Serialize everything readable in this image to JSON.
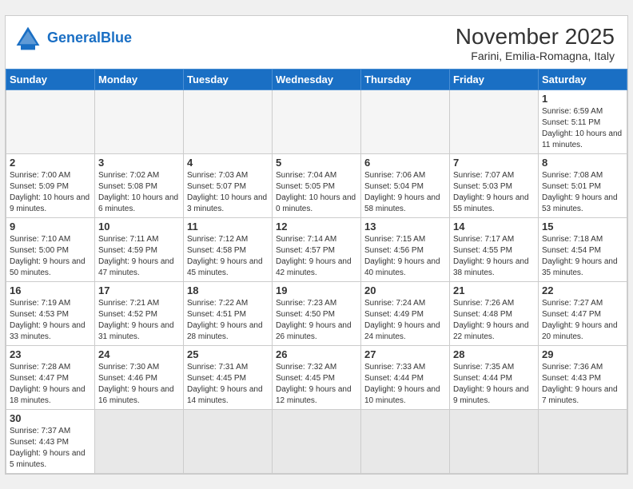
{
  "header": {
    "logo_general": "General",
    "logo_blue": "Blue",
    "month_year": "November 2025",
    "location": "Farini, Emilia-Romagna, Italy"
  },
  "days_of_week": [
    "Sunday",
    "Monday",
    "Tuesday",
    "Wednesday",
    "Thursday",
    "Friday",
    "Saturday"
  ],
  "weeks": [
    [
      {
        "day": null,
        "empty": true
      },
      {
        "day": null,
        "empty": true
      },
      {
        "day": null,
        "empty": true
      },
      {
        "day": null,
        "empty": true
      },
      {
        "day": null,
        "empty": true
      },
      {
        "day": null,
        "empty": true
      },
      {
        "day": 1,
        "info": "Sunrise: 6:59 AM\nSunset: 5:11 PM\nDaylight: 10 hours and 11 minutes."
      }
    ],
    [
      {
        "day": 2,
        "info": "Sunrise: 7:00 AM\nSunset: 5:09 PM\nDaylight: 10 hours and 9 minutes."
      },
      {
        "day": 3,
        "info": "Sunrise: 7:02 AM\nSunset: 5:08 PM\nDaylight: 10 hours and 6 minutes."
      },
      {
        "day": 4,
        "info": "Sunrise: 7:03 AM\nSunset: 5:07 PM\nDaylight: 10 hours and 3 minutes."
      },
      {
        "day": 5,
        "info": "Sunrise: 7:04 AM\nSunset: 5:05 PM\nDaylight: 10 hours and 0 minutes."
      },
      {
        "day": 6,
        "info": "Sunrise: 7:06 AM\nSunset: 5:04 PM\nDaylight: 9 hours and 58 minutes."
      },
      {
        "day": 7,
        "info": "Sunrise: 7:07 AM\nSunset: 5:03 PM\nDaylight: 9 hours and 55 minutes."
      },
      {
        "day": 8,
        "info": "Sunrise: 7:08 AM\nSunset: 5:01 PM\nDaylight: 9 hours and 53 minutes."
      }
    ],
    [
      {
        "day": 9,
        "info": "Sunrise: 7:10 AM\nSunset: 5:00 PM\nDaylight: 9 hours and 50 minutes."
      },
      {
        "day": 10,
        "info": "Sunrise: 7:11 AM\nSunset: 4:59 PM\nDaylight: 9 hours and 47 minutes."
      },
      {
        "day": 11,
        "info": "Sunrise: 7:12 AM\nSunset: 4:58 PM\nDaylight: 9 hours and 45 minutes."
      },
      {
        "day": 12,
        "info": "Sunrise: 7:14 AM\nSunset: 4:57 PM\nDaylight: 9 hours and 42 minutes."
      },
      {
        "day": 13,
        "info": "Sunrise: 7:15 AM\nSunset: 4:56 PM\nDaylight: 9 hours and 40 minutes."
      },
      {
        "day": 14,
        "info": "Sunrise: 7:17 AM\nSunset: 4:55 PM\nDaylight: 9 hours and 38 minutes."
      },
      {
        "day": 15,
        "info": "Sunrise: 7:18 AM\nSunset: 4:54 PM\nDaylight: 9 hours and 35 minutes."
      }
    ],
    [
      {
        "day": 16,
        "info": "Sunrise: 7:19 AM\nSunset: 4:53 PM\nDaylight: 9 hours and 33 minutes."
      },
      {
        "day": 17,
        "info": "Sunrise: 7:21 AM\nSunset: 4:52 PM\nDaylight: 9 hours and 31 minutes."
      },
      {
        "day": 18,
        "info": "Sunrise: 7:22 AM\nSunset: 4:51 PM\nDaylight: 9 hours and 28 minutes."
      },
      {
        "day": 19,
        "info": "Sunrise: 7:23 AM\nSunset: 4:50 PM\nDaylight: 9 hours and 26 minutes."
      },
      {
        "day": 20,
        "info": "Sunrise: 7:24 AM\nSunset: 4:49 PM\nDaylight: 9 hours and 24 minutes."
      },
      {
        "day": 21,
        "info": "Sunrise: 7:26 AM\nSunset: 4:48 PM\nDaylight: 9 hours and 22 minutes."
      },
      {
        "day": 22,
        "info": "Sunrise: 7:27 AM\nSunset: 4:47 PM\nDaylight: 9 hours and 20 minutes."
      }
    ],
    [
      {
        "day": 23,
        "info": "Sunrise: 7:28 AM\nSunset: 4:47 PM\nDaylight: 9 hours and 18 minutes."
      },
      {
        "day": 24,
        "info": "Sunrise: 7:30 AM\nSunset: 4:46 PM\nDaylight: 9 hours and 16 minutes."
      },
      {
        "day": 25,
        "info": "Sunrise: 7:31 AM\nSunset: 4:45 PM\nDaylight: 9 hours and 14 minutes."
      },
      {
        "day": 26,
        "info": "Sunrise: 7:32 AM\nSunset: 4:45 PM\nDaylight: 9 hours and 12 minutes."
      },
      {
        "day": 27,
        "info": "Sunrise: 7:33 AM\nSunset: 4:44 PM\nDaylight: 9 hours and 10 minutes."
      },
      {
        "day": 28,
        "info": "Sunrise: 7:35 AM\nSunset: 4:44 PM\nDaylight: 9 hours and 9 minutes."
      },
      {
        "day": 29,
        "info": "Sunrise: 7:36 AM\nSunset: 4:43 PM\nDaylight: 9 hours and 7 minutes."
      }
    ],
    [
      {
        "day": 30,
        "info": "Sunrise: 7:37 AM\nSunset: 4:43 PM\nDaylight: 9 hours and 5 minutes."
      },
      {
        "day": null,
        "empty": true
      },
      {
        "day": null,
        "empty": true
      },
      {
        "day": null,
        "empty": true
      },
      {
        "day": null,
        "empty": true
      },
      {
        "day": null,
        "empty": true
      },
      {
        "day": null,
        "empty": true
      }
    ]
  ]
}
